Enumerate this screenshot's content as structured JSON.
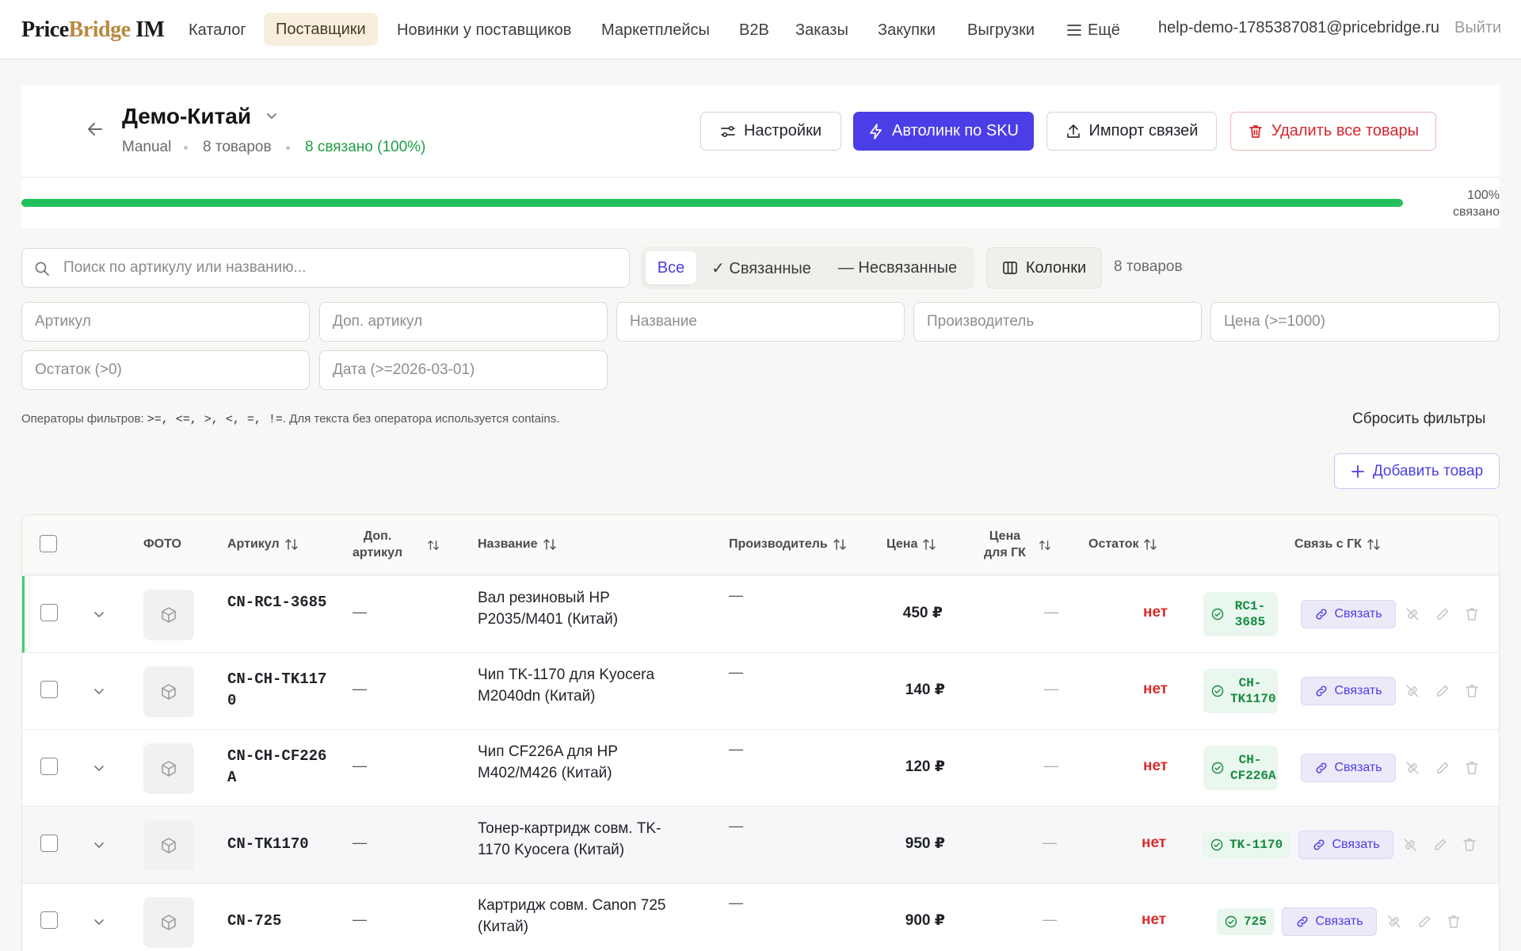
{
  "nav": {
    "logo_price": "Price",
    "logo_bridge": "Bridge",
    "logo_im": " IM",
    "items": [
      "Каталог",
      "Поставщики",
      "Новинки у поставщиков",
      "Маркетплейсы",
      "B2B",
      "Заказы",
      "Закупки",
      "Выгрузки",
      "Ещё"
    ],
    "active_item": "Поставщики",
    "user_email": "help-demo-1785387081@pricebridge.ru",
    "logout": "Выйти"
  },
  "header": {
    "title": "Демо-Китай",
    "type": "Manual",
    "products_count": "8 товаров",
    "linked_status": "8 связано (100%)",
    "buttons": {
      "settings": "Настройки",
      "autolink": "Автолинк по SKU",
      "import": "Импорт связей",
      "delete_all": "Удалить все товары"
    },
    "progress": {
      "percent": 100,
      "label_pct": "100%",
      "label_text": "связано"
    }
  },
  "search": {
    "placeholder": "Поиск по артикулу или названию..."
  },
  "segment": {
    "all": "Все",
    "linked": "✓ Связанные",
    "unlinked": "— Несвязанные",
    "active": "Все"
  },
  "columns_button": "Колонки",
  "items_count": "8 товаров",
  "filters": {
    "article": "Артикул",
    "extra_article": "Доп. артикул",
    "name": "Название",
    "manufacturer": "Производитель",
    "price": "Цена (>=1000)",
    "stock": "Остаток (>0)",
    "date": "Дата (>=2026-03-01)"
  },
  "hint": {
    "prefix": "Операторы фильтров: ",
    "operators": ">=, <=, >, <, =, !=",
    "suffix": ". Для текста без оператора используется contains."
  },
  "reset_filters": "Сбросить фильтры",
  "add_product": "Добавить товар",
  "table": {
    "headers": {
      "photo": "ФОТО",
      "article": "Артикул",
      "extra_article_1": "Доп.",
      "extra_article_2": "артикул",
      "name": "Название",
      "manufacturer": "Производитель",
      "price": "Цена",
      "gk_price_1": "Цена",
      "gk_price_2": "для ГК",
      "stock": "Остаток",
      "gk_link": "Связь с ГК"
    },
    "link_button": "Связать",
    "rows": [
      {
        "sku": "CN-RC1-3685",
        "extra": "—",
        "name": "Вал резиновый HP P2035/M401 (Китай)",
        "manufacturer": "—",
        "price": "450 ₽",
        "gk_price": "—",
        "stock": "нет",
        "gk": "RC1-3685"
      },
      {
        "sku": "CN-CH-TK1170",
        "extra": "—",
        "name": "Чип TK-1170 для Kyocera M2040dn (Китай)",
        "manufacturer": "—",
        "price": "140 ₽",
        "gk_price": "—",
        "stock": "нет",
        "gk": "CH-TK1170"
      },
      {
        "sku": "CN-CH-CF226A",
        "extra": "—",
        "name": "Чип CF226A для HP M402/M426 (Китай)",
        "manufacturer": "—",
        "price": "120 ₽",
        "gk_price": "—",
        "stock": "нет",
        "gk": "CH-CF226A"
      },
      {
        "sku": "CN-TK1170",
        "extra": "—",
        "name": "Тонер-картридж совм. TK-1170 Kyocera (Китай)",
        "manufacturer": "—",
        "price": "950 ₽",
        "gk_price": "—",
        "stock": "нет",
        "gk": "TK-1170"
      },
      {
        "sku": "CN-725",
        "extra": "—",
        "name": "Картридж совм. Canon 725 (Китай)",
        "manufacturer": "—",
        "price": "900 ₽",
        "gk_price": "—",
        "stock": "нет",
        "gk": "725"
      }
    ]
  },
  "colors": {
    "accent": "#4c3ee6",
    "success": "#22c05a",
    "danger": "#dc2b2b",
    "nav_active_bg": "#f8eedd"
  }
}
